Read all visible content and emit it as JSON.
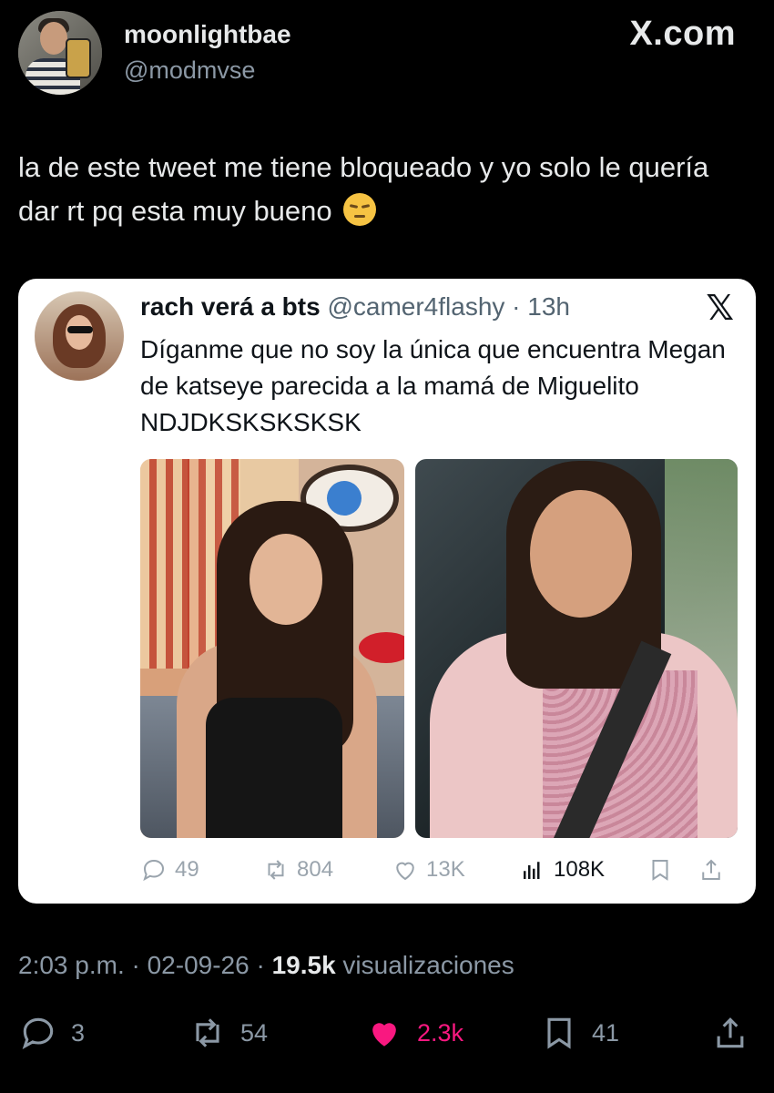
{
  "author": {
    "name": "moonlightbae",
    "handle": "@modmvse"
  },
  "brand": "X.com",
  "tweet": {
    "text": "la de este tweet me tiene bloqueado y yo solo le quería dar rt pq esta muy bueno"
  },
  "quoted": {
    "name": "rach verá a bts",
    "meta": "@camer4flashy · 13h",
    "text": "Díganme que no soy la única que encuentra Megan de katseye parecida a la mamá de Miguelito NDJDKSKSKSKSK",
    "actions": {
      "replies": "49",
      "reposts": "804",
      "likes": "13K",
      "views": "108K"
    }
  },
  "timestamp": {
    "time": "2:03 p.m. · 02-09-26 · ",
    "views": "19.5k",
    "views_label": " visualizaciones"
  },
  "actions": {
    "replies": "3",
    "reposts": "54",
    "likes": "2.3k",
    "bookmarks": "41"
  },
  "colors": {
    "like": "#f91880",
    "secondary": "#8b98a5",
    "background": "#000000"
  }
}
